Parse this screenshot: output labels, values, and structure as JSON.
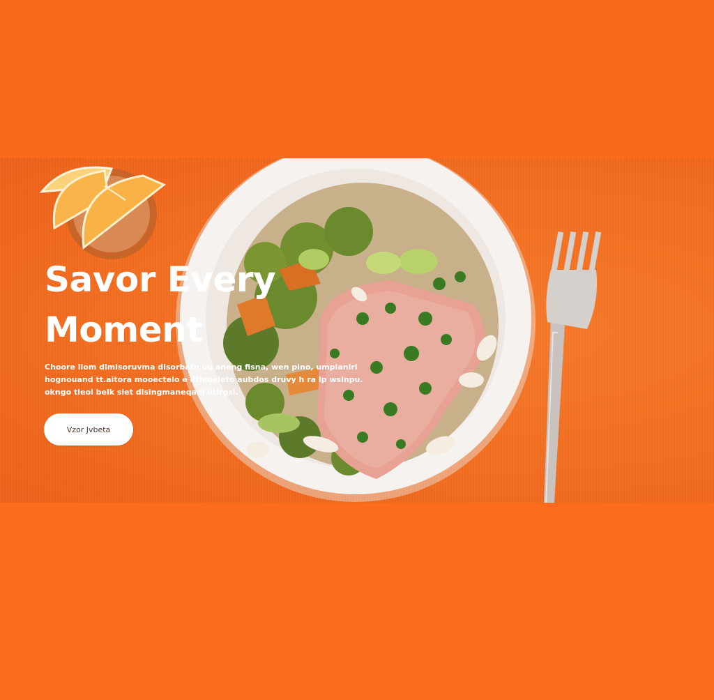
{
  "hero": {
    "headline": "Savor Every Moment",
    "body": "Choore liom dlmisoruvma dlsorbatn ou aneng fisna, wen pino, umplanlrl hognouand tt.aitora mooectelo e dthmeleto aubdos druvy h ra lp wsinpu. okngo tleol belk slet dlsingmaneqadl iitlrgsi.",
    "cta_label": "Vzor Jvbeta"
  },
  "colors": {
    "page_background": "#fb6a1c",
    "hero_background": "#f2701f",
    "text": "#ffffff",
    "button_background": "#ffffff"
  }
}
